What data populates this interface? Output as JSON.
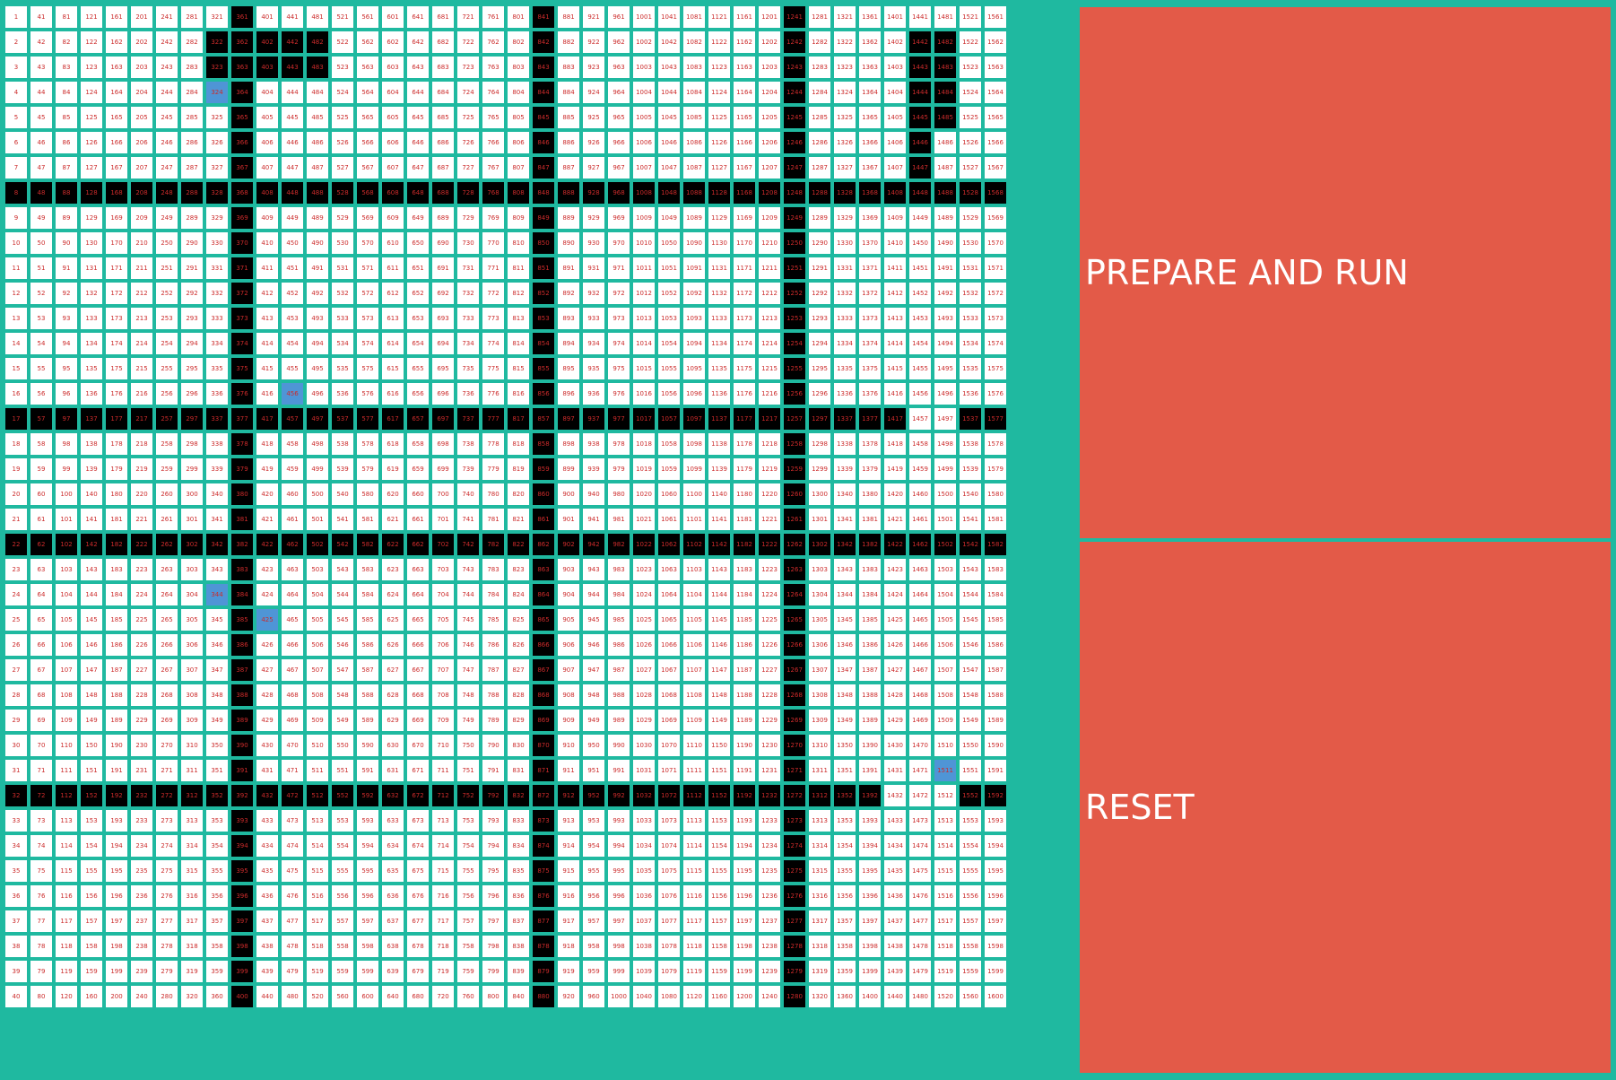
{
  "grid": {
    "rows": 40,
    "cols": 40,
    "colors": {
      "background": "#1fb9a0",
      "cell": "#ffffff",
      "wall": "#000000",
      "node": "#4f95d6",
      "number": "#cc2b2b"
    },
    "wall_columns": [
      10,
      22,
      32
    ],
    "wall_rows": [
      8,
      17,
      22,
      32
    ],
    "wall_cells": [
      322,
      323,
      362,
      363,
      402,
      403,
      442,
      443,
      482,
      483,
      1442,
      1443,
      1444,
      1445,
      1446,
      1447,
      1482,
      1483,
      1484,
      1485
    ],
    "open_cells": [
      1061,
      1101,
      1457,
      1458,
      1497,
      1498,
      1547,
      1587,
      1129,
      1569,
      1432,
      1472,
      1512
    ],
    "node_cells": [
      324,
      456,
      344,
      425,
      1511
    ]
  },
  "controls": {
    "run_label": "PREPARE AND RUN",
    "reset_label": "RESET"
  }
}
